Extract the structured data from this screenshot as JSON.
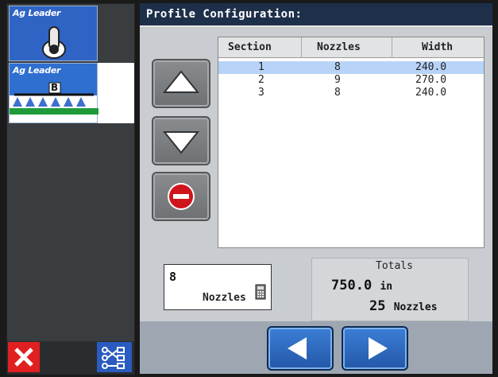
{
  "sidebar": {
    "tile_toggle": {
      "brand": "Ag Leader",
      "icon": "toggle-switch-icon"
    },
    "tile_boom": {
      "brand": "Ag Leader",
      "badge": "B",
      "icon": "sprayer-boom-icon"
    },
    "cancel_icon": "close-icon",
    "schema_icon": "configuration-schema-icon",
    "colors": {
      "brand_blue": "#2f63c4",
      "cancel_red": "#e02020"
    }
  },
  "header": {
    "title": "Profile Configuration:"
  },
  "controls": {
    "up_icon": "arrow-up-icon",
    "down_icon": "arrow-down-icon",
    "delete_icon": "delete-icon"
  },
  "table": {
    "columns": [
      "Section",
      "Nozzles",
      "Width"
    ],
    "rows": [
      {
        "section": "1",
        "nozzles": "8",
        "width": "240.0",
        "selected": true
      },
      {
        "section": "2",
        "nozzles": "9",
        "width": "270.0",
        "selected": false
      },
      {
        "section": "3",
        "nozzles": "8",
        "width": "240.0",
        "selected": false
      }
    ]
  },
  "nozzle_input": {
    "value": "8",
    "unit": "Nozzles",
    "icon": "calculator-icon"
  },
  "totals": {
    "label": "Totals",
    "width_value": "750.0",
    "width_unit": "in",
    "nozzle_count": "25",
    "nozzle_unit": "Nozzles"
  },
  "footer": {
    "prev_icon": "arrow-left-icon",
    "next_icon": "arrow-right-icon"
  }
}
